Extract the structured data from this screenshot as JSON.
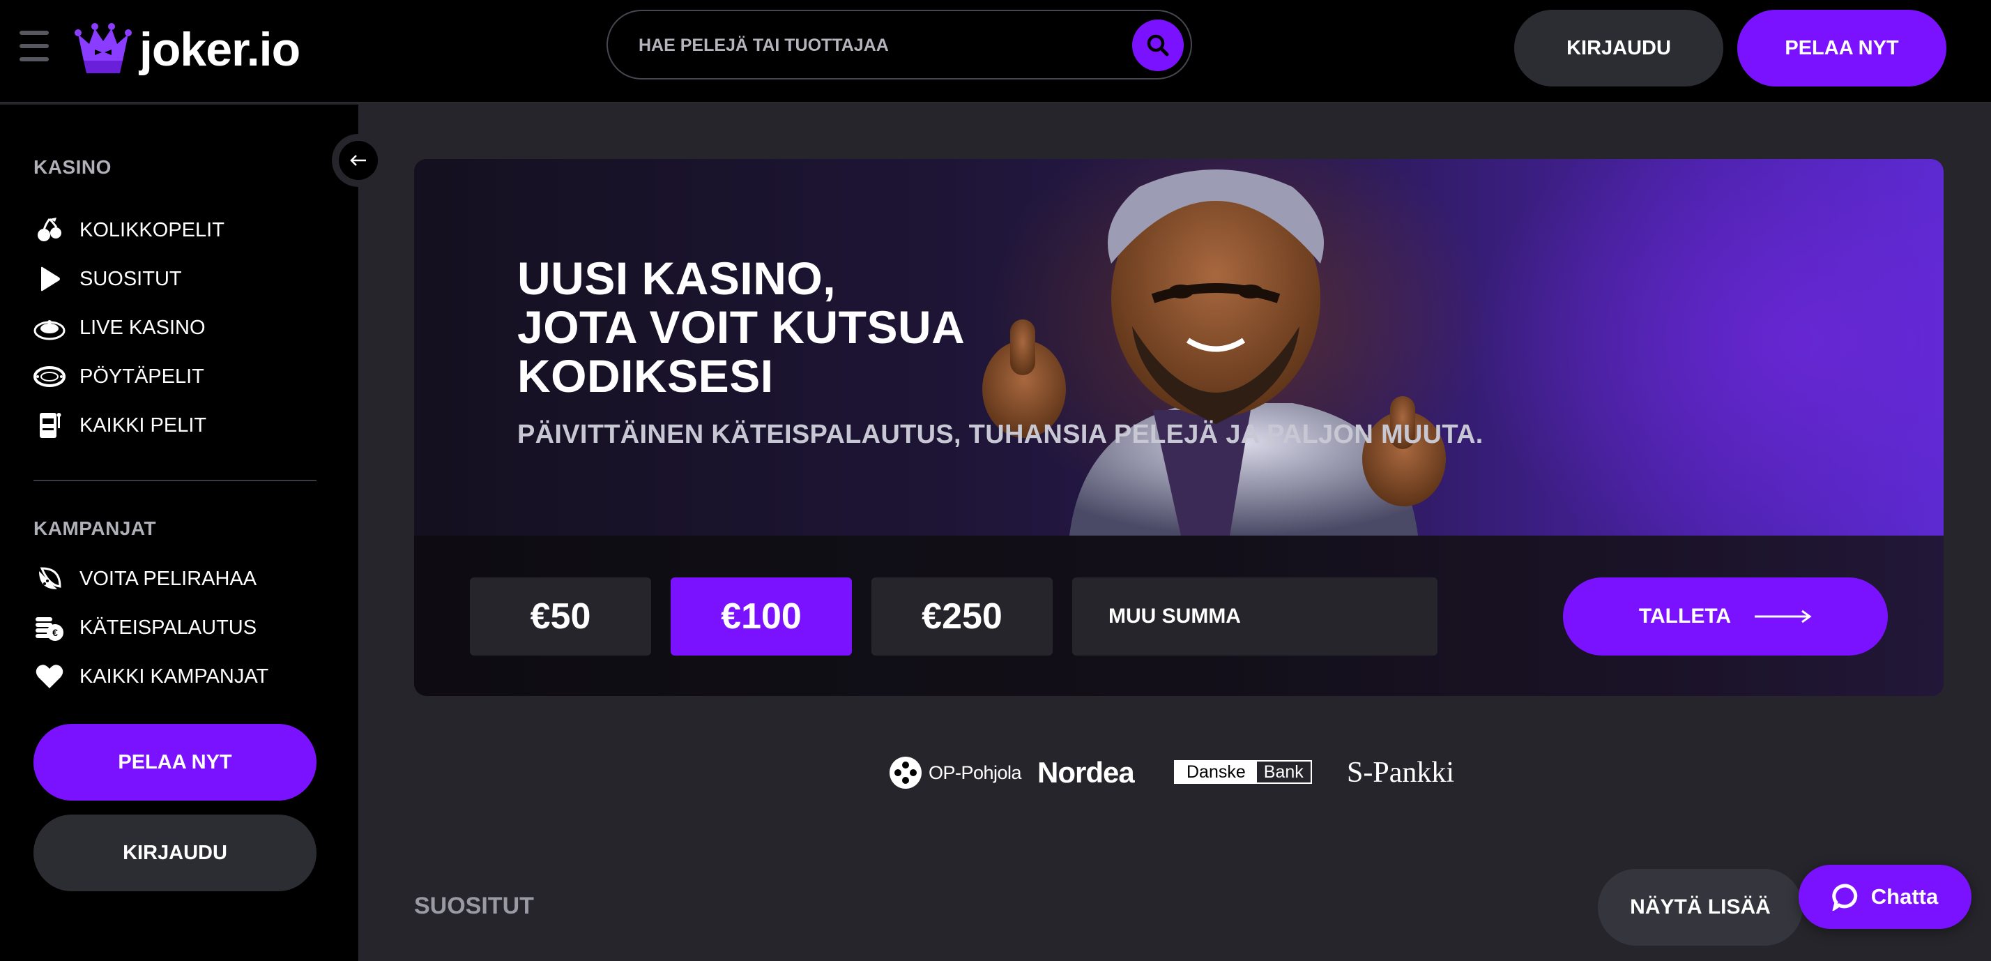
{
  "header": {
    "logo_text": "joker.io",
    "search_placeholder": "HAE PELEJÄ TAI TUOTTAJAA",
    "login_label": "KIRJAUDU",
    "play_label": "PELAA NYT"
  },
  "sidebar": {
    "casino_title": "KASINO",
    "casino_items": [
      {
        "label": "KOLIKKOPELIT",
        "icon": "cherries-icon"
      },
      {
        "label": "SUOSITUT",
        "icon": "play-icon"
      },
      {
        "label": "LIVE KASINO",
        "icon": "roulette-icon"
      },
      {
        "label": "PÖYTÄPELIT",
        "icon": "poker-table-icon"
      },
      {
        "label": "KAIKKI PELIT",
        "icon": "slot-machine-icon"
      }
    ],
    "promo_title": "KAMPANJAT",
    "promo_items": [
      {
        "label": "VOITA PELIRAHAA",
        "icon": "melon-icon"
      },
      {
        "label": "KÄTEISPALAUTUS",
        "icon": "coins-icon"
      },
      {
        "label": "KAIKKI KAMPANJAT",
        "icon": "heart-icon"
      }
    ],
    "play_label": "PELAA NYT",
    "login_label": "KIRJAUDU"
  },
  "hero": {
    "title_lines": [
      "UUSI KASINO,",
      "JOTA VOIT KUTSUA",
      "KODIKSESI"
    ],
    "subtitle": "PÄIVITTÄINEN KÄTEISPALAUTUS, TUHANSIA PELEJÄ JA PALJON MUUTA.",
    "amounts": [
      "€50",
      "€100",
      "€250"
    ],
    "selected_amount": "€100",
    "other_amount_placeholder": "MUU SUMMA",
    "deposit_label": "TALLETA"
  },
  "banks": {
    "op": "OP-Pohjola",
    "nordea": "Nordea",
    "danske_a": "Danske",
    "danske_b": "Bank",
    "spankki": "S-Pankki"
  },
  "section": {
    "title": "SUOSITUT",
    "show_more_label": "NÄYTÄ LISÄÄ"
  },
  "chat": {
    "label": "Chatta"
  },
  "colors": {
    "accent": "#7b12ff",
    "background": "#25252b",
    "sidebar": "#000000",
    "button_dark": "#2c2c33"
  }
}
